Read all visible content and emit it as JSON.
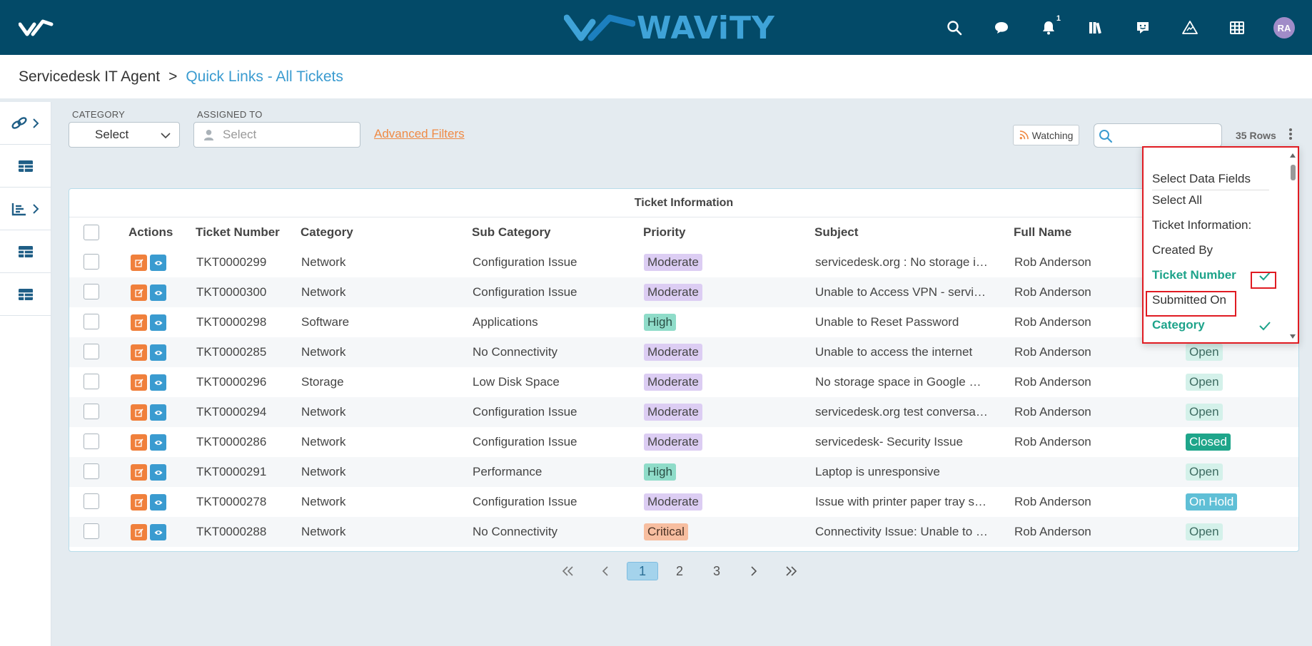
{
  "topbar": {
    "brand": "WAViTY",
    "notification_count": "1",
    "avatar_initials": "RA",
    "colors": {
      "bar": "#034a68",
      "brand": "#3fa3d8"
    }
  },
  "breadcrumb": {
    "root": "Servicedesk IT Agent",
    "separator": ">",
    "current": "Quick Links - All Tickets"
  },
  "filters": {
    "category_label": "CATEGORY",
    "category_value": "Select",
    "assigned_label": "ASSIGNED TO",
    "assigned_placeholder": "Select",
    "advanced_filters": "Advanced Filters",
    "watching": "Watching",
    "rows_count": "35 Rows"
  },
  "table": {
    "group_title": "Ticket Information",
    "columns": [
      "Actions",
      "Ticket Number",
      "Category",
      "Sub Category",
      "Priority",
      "Subject",
      "Full Name"
    ],
    "rows": [
      {
        "ticket": "TKT0000299",
        "category": "Network",
        "sub": "Configuration Issue",
        "priority": "Moderate",
        "subject": "servicedesk.org : No storage in …",
        "name": "Rob Anderson",
        "status": ""
      },
      {
        "ticket": "TKT0000300",
        "category": "Network",
        "sub": "Configuration Issue",
        "priority": "Moderate",
        "subject": "Unable to Access VPN - service…",
        "name": "Rob Anderson",
        "status": ""
      },
      {
        "ticket": "TKT0000298",
        "category": "Software",
        "sub": "Applications",
        "priority": "High",
        "subject": "Unable to Reset Password",
        "name": "Rob Anderson",
        "status": ""
      },
      {
        "ticket": "TKT0000285",
        "category": "Network",
        "sub": "No Connectivity",
        "priority": "Moderate",
        "subject": "Unable to access the internet",
        "name": "Rob Anderson",
        "status": "Open"
      },
      {
        "ticket": "TKT0000296",
        "category": "Storage",
        "sub": "Low Disk Space",
        "priority": "Moderate",
        "subject": "No storage space in Google Dri…",
        "name": "Rob Anderson",
        "status": "Open"
      },
      {
        "ticket": "TKT0000294",
        "category": "Network",
        "sub": "Configuration Issue",
        "priority": "Moderate",
        "subject": "servicedesk.org test conversati…",
        "name": "Rob Anderson",
        "status": "Open"
      },
      {
        "ticket": "TKT0000286",
        "category": "Network",
        "sub": "Configuration Issue",
        "priority": "Moderate",
        "subject": "servicedesk- Security Issue",
        "name": "Rob Anderson",
        "status": "Closed"
      },
      {
        "ticket": "TKT0000291",
        "category": "Network",
        "sub": "Performance",
        "priority": "High",
        "subject": "Laptop is unresponsive",
        "name": "",
        "status": "Open"
      },
      {
        "ticket": "TKT0000278",
        "category": "Network",
        "sub": "Configuration Issue",
        "priority": "Moderate",
        "subject": "Issue with printer paper tray se…",
        "name": "Rob Anderson",
        "status": "On Hold"
      },
      {
        "ticket": "TKT0000288",
        "category": "Network",
        "sub": "No Connectivity",
        "priority": "Critical",
        "subject": "Connectivity Issue: Unable to …",
        "name": "Rob Anderson",
        "status": "Open"
      }
    ]
  },
  "pagination": {
    "first": "«",
    "prev": "‹",
    "pages": [
      "1",
      "2",
      "3"
    ],
    "active_page": "1",
    "next": "›",
    "last": "»"
  },
  "dropdown": {
    "title": "Select Data Fields",
    "items": [
      {
        "label": "Select All",
        "checked": false
      },
      {
        "label": "Ticket Information:",
        "checked": false
      },
      {
        "label": "Created By",
        "checked": false
      },
      {
        "label": "Ticket Number",
        "checked": true
      },
      {
        "label": "Submitted On",
        "checked": false
      },
      {
        "label": "Category",
        "checked": true
      }
    ],
    "highlight_color": "#e01b22",
    "check_color": "#1da38a"
  }
}
